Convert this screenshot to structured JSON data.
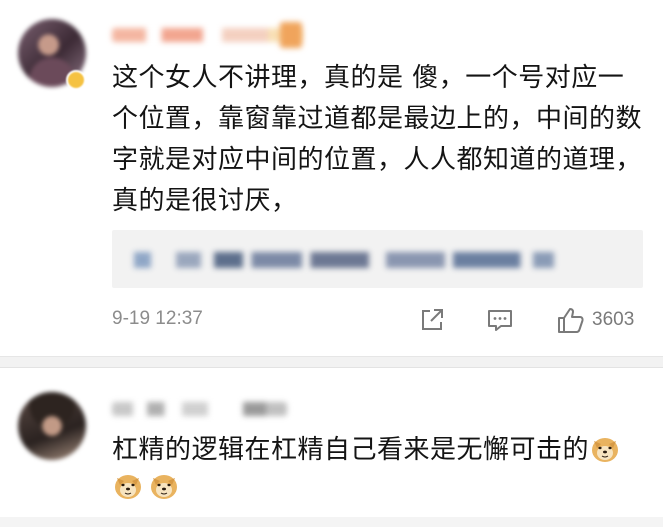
{
  "comment1": {
    "text": "这个女人不讲理，真的是 傻，一个号对应一个位置，靠窗靠过道都是最边上的，中间的数字就是对应中间的位置，人人都知道的道理，真的是很讨厌，",
    "time": "9-19 12:37",
    "likes": "3603",
    "icons": {
      "share": "share-icon",
      "reply": "comment-icon",
      "like": "thumbs-up-icon"
    }
  },
  "comment2": {
    "text": "杠精的逻辑在杠精自己看来是无懈可击的",
    "emoji": "doge-emoji"
  },
  "colors": {
    "text": "#141414",
    "meta": "#8c8c8c",
    "quote_bg": "#f2f2f2",
    "divider": "#f2f2f2"
  }
}
